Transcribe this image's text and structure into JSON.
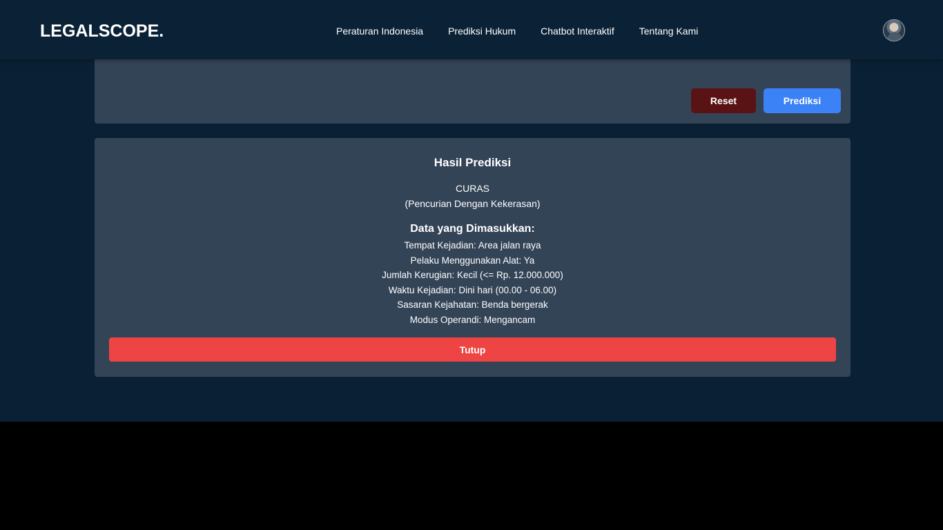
{
  "header": {
    "brand": "LEGALSCOPE.",
    "nav": [
      {
        "label": "Peraturan Indonesia"
      },
      {
        "label": "Prediksi Hukum"
      },
      {
        "label": "Chatbot Interaktif"
      },
      {
        "label": "Tentang Kami"
      }
    ],
    "avatar_icon": "user-avatar"
  },
  "form": {
    "reset_label": "Reset",
    "predict_label": "Prediksi"
  },
  "result": {
    "title": "Hasil Prediksi",
    "code": "CURAS",
    "description": "(Pencurian Dengan Kekerasan)",
    "data_title": "Data yang Dimasukkan:",
    "data_items": [
      "Tempat Kejadian: Area jalan raya",
      "Pelaku Menggunakan Alat: Ya",
      "Jumlah Kerugian: Kecil (<= Rp. 12.000.000)",
      "Waktu Kejadian: Dini hari (00.00 - 06.00)",
      "Sasaran Kejahatan: Benda bergerak",
      "Modus Operandi: Mengancam"
    ],
    "close_label": "Tutup"
  },
  "colors": {
    "background": "#0a2135",
    "panel": "#344457",
    "reset": "#5a1315",
    "predict": "#3b82f6",
    "close": "#ef4444"
  }
}
